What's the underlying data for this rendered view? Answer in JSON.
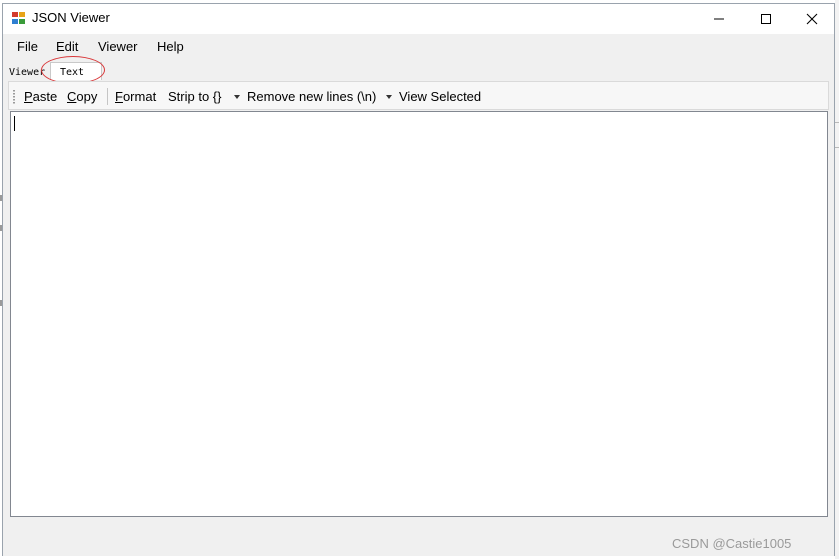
{
  "window": {
    "title": "JSON Viewer"
  },
  "menu": [
    "File",
    "Edit",
    "Viewer",
    "Help"
  ],
  "tabs": {
    "viewer": "Viewer",
    "text": "Text"
  },
  "toolbar": {
    "paste": {
      "u": "P",
      "rest": "aste"
    },
    "copy": {
      "u": "C",
      "rest": "opy"
    },
    "format": {
      "u": "F",
      "rest": "ormat"
    },
    "strip": "Strip to {}",
    "remove_newlines": "Remove new lines (\\n)",
    "view_selected": "View Selected"
  },
  "editor": {
    "value": ""
  },
  "watermark": "CSDN @Castie1005",
  "colors": {
    "highlight_circle": "#d9383a"
  }
}
